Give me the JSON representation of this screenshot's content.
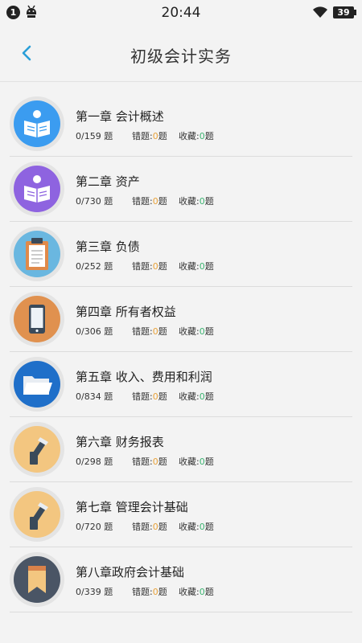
{
  "status_bar": {
    "notification_count": "1",
    "time": "20:44",
    "battery": "39"
  },
  "header": {
    "title": "初级会计实务"
  },
  "labels": {
    "unit": "题",
    "wrong": "错题:",
    "favorite": "收藏:"
  },
  "colors": {
    "accent": "#2a9fd8",
    "wrong_count": "#e8a23a",
    "favorite_count": "#3cb371"
  },
  "chapters": [
    {
      "title": "第一章 会计概述",
      "progress": "0/159",
      "wrong": "0",
      "favorite": "0",
      "icon": "reading-person-icon",
      "color": "#3b9cf0"
    },
    {
      "title": "第二章 资产",
      "progress": "0/730",
      "wrong": "0",
      "favorite": "0",
      "icon": "reading-person-icon",
      "color": "#8e63e0"
    },
    {
      "title": "第三章 负债",
      "progress": "0/252",
      "wrong": "0",
      "favorite": "0",
      "icon": "clipboard-icon",
      "color": "#6ab7e0"
    },
    {
      "title": "第四章 所有者权益",
      "progress": "0/306",
      "wrong": "0",
      "favorite": "0",
      "icon": "phone-icon",
      "color": "#e0914f"
    },
    {
      "title": "第五章 收入、费用和利润",
      "progress": "0/834",
      "wrong": "0",
      "favorite": "0",
      "icon": "folder-icon",
      "color": "#1f6fc9"
    },
    {
      "title": "第六章 财务报表",
      "progress": "0/298",
      "wrong": "0",
      "favorite": "0",
      "icon": "lamp-icon",
      "color": "#f3c680"
    },
    {
      "title": "第七章 管理会计基础",
      "progress": "0/720",
      "wrong": "0",
      "favorite": "0",
      "icon": "lamp-icon",
      "color": "#f3c680"
    },
    {
      "title": "第八章政府会计基础",
      "progress": "0/339",
      "wrong": "0",
      "favorite": "0",
      "icon": "bookmark-icon",
      "color": "#4a5565"
    }
  ]
}
